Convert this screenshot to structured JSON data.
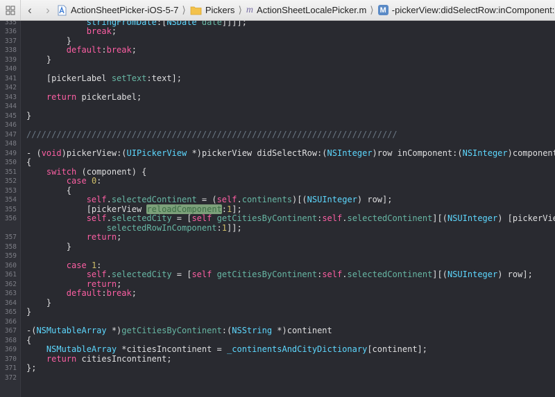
{
  "jumpbar": {
    "project": "ActionSheetPicker-iOS-5-7",
    "group": "Pickers",
    "file_badge": "m",
    "file": "ActionSheetLocalePicker.m",
    "method_badge": "M",
    "method": "-pickerView:didSelectRow:inComponent:"
  },
  "colors": {
    "keyword": "#fc5fa3",
    "type": "#5dd8ff",
    "method": "#67b7a4",
    "number": "#d0bf69",
    "comment": "#6c7986",
    "background": "#292a30",
    "highlight": "#7ca07a"
  },
  "lines": [
    {
      "n": "335",
      "cut": true
    },
    {
      "n": "336"
    },
    {
      "n": "337"
    },
    {
      "n": "338"
    },
    {
      "n": "339"
    },
    {
      "n": "340"
    },
    {
      "n": "341"
    },
    {
      "n": "342"
    },
    {
      "n": "343"
    },
    {
      "n": "344"
    },
    {
      "n": "345"
    },
    {
      "n": "346"
    },
    {
      "n": "347"
    },
    {
      "n": "348"
    },
    {
      "n": "349"
    },
    {
      "n": "350"
    },
    {
      "n": "351"
    },
    {
      "n": "352"
    },
    {
      "n": "353"
    },
    {
      "n": "354"
    },
    {
      "n": "355"
    },
    {
      "n": "356"
    },
    {
      "n": ""
    },
    {
      "n": "357"
    },
    {
      "n": "358"
    },
    {
      "n": "359"
    },
    {
      "n": "360"
    },
    {
      "n": "361"
    },
    {
      "n": "362"
    },
    {
      "n": "363"
    },
    {
      "n": "364"
    },
    {
      "n": "365"
    },
    {
      "n": "366"
    },
    {
      "n": "367"
    },
    {
      "n": "368"
    },
    {
      "n": "369"
    },
    {
      "n": "370"
    },
    {
      "n": "371"
    },
    {
      "n": "372"
    }
  ],
  "code": {
    "l335a": "        self.",
    "l335b": "stringFromDate",
    "l335c": ":[",
    "l335d": "NSDate",
    "l335e": " ",
    "l335f": "date",
    "l335g": "]]]];",
    "prefix335": "            ",
    "break": "break",
    "semi": ";",
    "close": "}",
    "default": "default",
    "colon": ":",
    "pickerLabel": "[pickerLabel ",
    "setText": "setText",
    "setTextRest": ":text];",
    "return": "return",
    "retRest": " pickerLabel;",
    "comment_sep": "//////////////////////////////////////////////////////////////////////////",
    "sig_a": "- (",
    "void": "void",
    "sig_b": ")pickerView:(",
    "UIPickerView": "UIPickerView",
    "sig_c": " *)pickerView didSelectRow:(",
    "NSInteger": "NSInteger",
    "sig_d": ")row inComponent:(",
    "sig_e": ")component",
    "open": "{",
    "switch": "switch",
    "switchRest": " (component) {",
    "case": "case",
    "zero": "0",
    "one": "1",
    "self": "self",
    "dot": ".",
    "selectedContinent": "selectedContinent",
    "eqParen": " = (",
    "continents": "continents",
    "brBr": ")[(",
    "NSUInteger": "NSUInteger",
    "rowClose": ") row];",
    "pickerView": "[pickerView ",
    "reloadComponent": "reloadComponent",
    "colonOne": ":",
    "closeBr": "];",
    "selectedCity": "selectedCity",
    "eqBr": " = [",
    "getCities": "getCitiesByContinent",
    "brBr2": "][(",
    "pvOpen": ") [pickerView",
    "selectedRowInComponent": "selectedRowInComponent",
    "dblClose": "]];",
    "rowClose2": ") row];",
    "defaultBreak": ":",
    "ret2": "return",
    "fnA": "-(",
    "NSMutableArray": "NSMutableArray",
    "fnB": " *)",
    "fnName": "getCitiesByContinent",
    "fnC": ":(",
    "NSString": "NSString",
    "fnD": " *)continent",
    "citiesVar": " *citiesIncontinent = ",
    "dict": "_continentsAndCityDictionary",
    "dictRest": "[continent];",
    "retCities": " citiesIncontinent;",
    "endFn": "};"
  }
}
